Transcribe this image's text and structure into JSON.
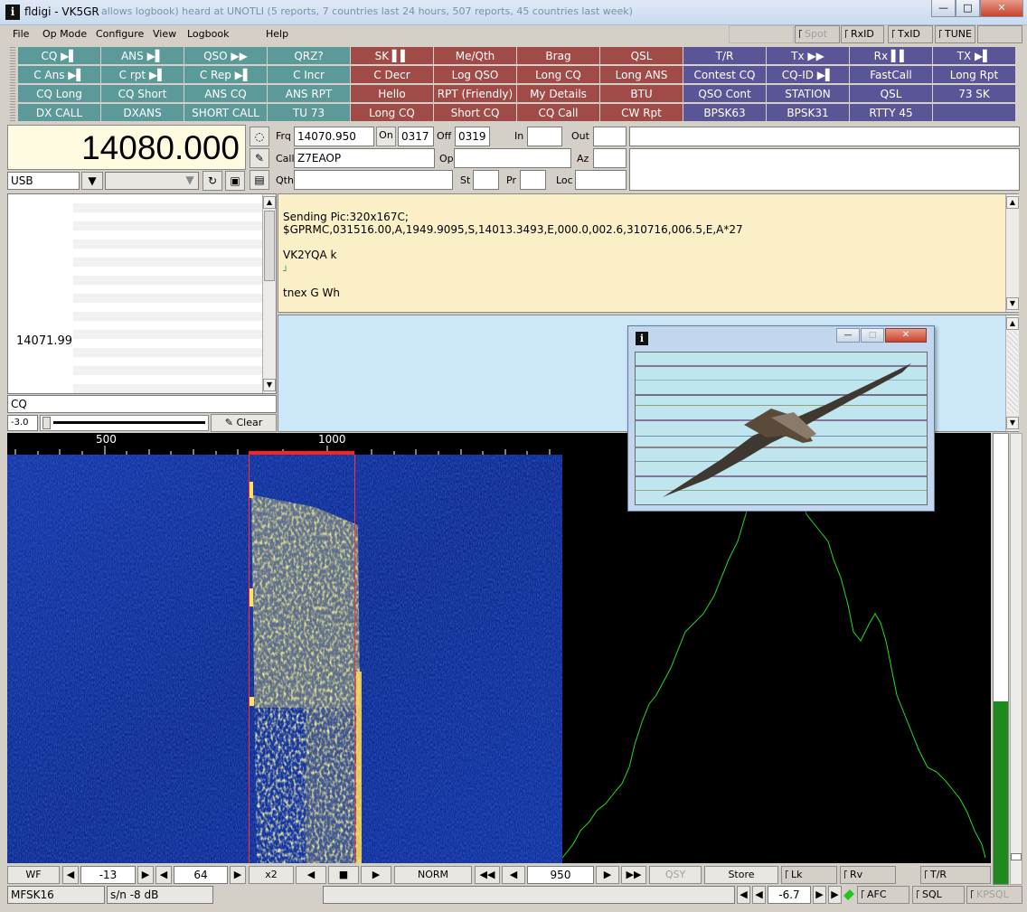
{
  "window": {
    "title": "fldigi - VK5GR",
    "ghost_text": "allows logbook) heard at UNOTLI (5 reports, 7 countries last 24 hours, 507 reports, 45 countries last week)"
  },
  "menu": [
    "File",
    "Op Mode",
    "Configure",
    "View",
    "Logbook",
    "Help"
  ],
  "toggles": {
    "spot": "Spot",
    "rxid": "RxID",
    "txid": "TxID",
    "tune": "TUNE"
  },
  "macros": [
    [
      "CQ ▶▌",
      "ANS ▶▌",
      "QSO ▶▶",
      "QRZ?",
      "SK ▌▌",
      "Me/Qth",
      "Brag",
      "QSL",
      "T/R",
      "Tx ▶▶",
      "Rx ▌▌",
      "TX ▶▌"
    ],
    [
      "C Ans ▶▌",
      "C rpt ▶▌",
      "C Rep ▶▌",
      "C Incr",
      "C Decr",
      "Log QSO",
      "Long CQ",
      "Long ANS",
      "Contest CQ",
      "CQ-ID ▶▌",
      "FastCall",
      "Long Rpt"
    ],
    [
      "CQ Long",
      "CQ Short",
      "ANS CQ",
      "ANS RPT",
      "Hello",
      "RPT (Friendly)",
      "My Details",
      "BTU",
      "QSO Cont",
      "STATION",
      "QSL",
      "73 SK"
    ],
    [
      "DX CALL",
      "DXANS",
      "SHORT CALL",
      "TU 73",
      "Long CQ",
      "Short CQ",
      "CQ Call",
      "CW Rpt",
      "BPSK63",
      "BPSK31",
      "RTTY 45",
      ""
    ]
  ],
  "rig": {
    "frequency": "14080.000",
    "mode": "USB",
    "frq_label": "Frq",
    "frq": "14070.950",
    "on_label": "On",
    "on": "0317",
    "off_label": "Off",
    "off": "0319",
    "in_label": "In",
    "in": "",
    "out_label": "Out",
    "out": "",
    "call_label": "Call",
    "call": "Z7EAOP",
    "op_label": "Op",
    "op": "",
    "az_label": "Az",
    "az": "",
    "qth_label": "Qth",
    "qth": "",
    "st_label": "St",
    "st": "",
    "pr_label": "Pr",
    "pr": "",
    "loc_label": "Loc",
    "loc": ""
  },
  "browser": {
    "freq": "14071.99",
    "filter": "CQ",
    "level": "-3.0",
    "clear": "Clear"
  },
  "rx_text": [
    "Sending Pic:320x167C;",
    "$GPRMC,031516.00,A,1949.9095,S,14013.3493,E,000.0,002.6,310716,006.5,E,A*27",
    "",
    "VK2YQA k",
    "┘",
    "  tnex G Wh"
  ],
  "scale": {
    "mark1": "500",
    "mark2": "1000"
  },
  "controls": {
    "wf": "WF",
    "reflevel": "-13",
    "range": "64",
    "zoom": "x2",
    "norm": "NORM",
    "carrier": "950",
    "qsy": "QSY",
    "store": "Store",
    "lk": "Lk",
    "rv": "Rv",
    "tr": "T/R"
  },
  "status": {
    "mode": "MFSK16",
    "sn": "s/n  -8 dB",
    "afc_value": "-6.7",
    "afc": "AFC",
    "sql": "SQL",
    "kpsql": "KPSQL"
  },
  "colors": {
    "macro_teal": "#5b9a98",
    "macro_red": "#a04b47",
    "macro_purple": "#5a5596",
    "waterfall_bg": "#0a2a8e",
    "signal": "#f0e060",
    "spectrum": "#22dd22"
  }
}
